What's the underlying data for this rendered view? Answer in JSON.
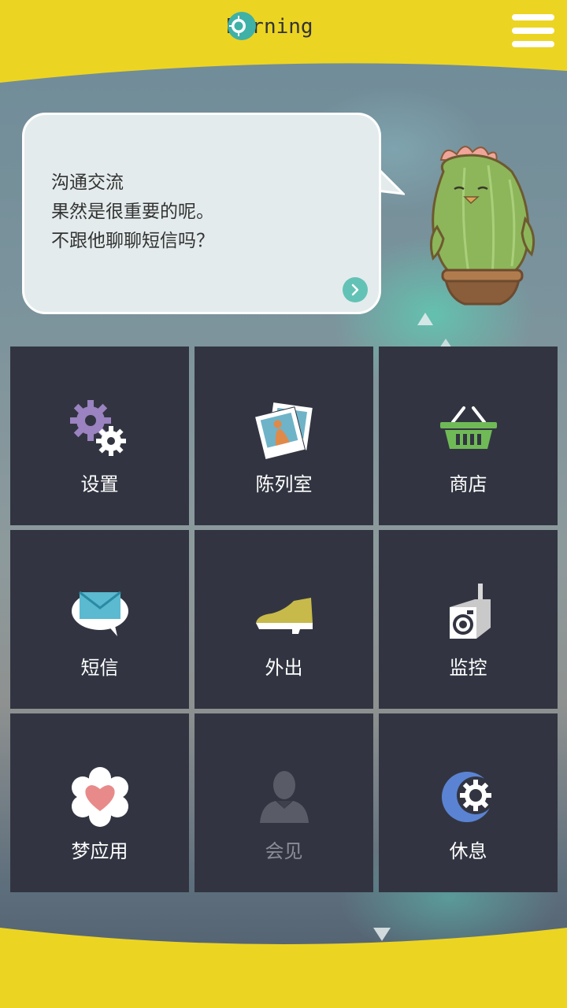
{
  "header": {
    "title": "Morning",
    "clock_icon": "clock-icon",
    "menu_icon": "hamburger-menu-icon",
    "bar_color": "#ecd423"
  },
  "bubble": {
    "lines": [
      "沟通交流",
      "果然是很重要的呢。",
      "不跟他聊聊短信吗？"
    ],
    "next_icon": "chevron-right-icon"
  },
  "mascot": {
    "name": "cactus-mascot"
  },
  "menu": {
    "tiles": [
      {
        "label": "设置",
        "icon": "gears-icon",
        "enabled": true
      },
      {
        "label": "陈列室",
        "icon": "photo-gallery-icon",
        "enabled": true
      },
      {
        "label": "商店",
        "icon": "shopping-basket-icon",
        "enabled": true
      },
      {
        "label": "短信",
        "icon": "message-envelope-icon",
        "enabled": true
      },
      {
        "label": "外出",
        "icon": "shoe-icon",
        "enabled": true
      },
      {
        "label": "监控",
        "icon": "camera-monitor-icon",
        "enabled": true
      },
      {
        "label": "梦应用",
        "icon": "heart-flower-icon",
        "enabled": true
      },
      {
        "label": "会见",
        "icon": "person-silhouette-icon",
        "enabled": false
      },
      {
        "label": "休息",
        "icon": "moon-rest-icon",
        "enabled": true
      }
    ]
  },
  "colors": {
    "accent_yellow": "#ecd423",
    "tile_background": "#323541",
    "teal": "#63c2b6"
  }
}
